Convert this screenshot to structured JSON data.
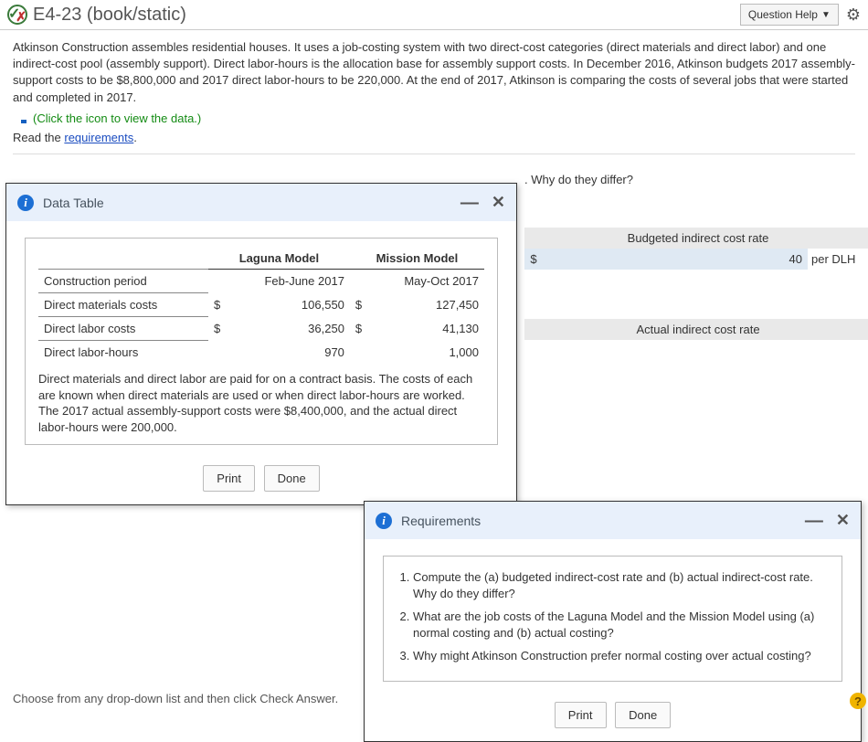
{
  "header": {
    "title": "E4-23 (book/static)",
    "help_label": "Question Help"
  },
  "problem_text": "Atkinson Construction assembles residential houses. It uses a job-costing system with two direct-cost categories (direct materials and direct labor) and one indirect-cost pool (assembly support). Direct labor-hours is the allocation base for assembly support costs. In December 2016, Atkinson budgets 2017 assembly-support costs to be $8,800,000 and 2017 direct labor-hours to be 220,000. At the end of 2017, Atkinson is comparing the costs of several jobs that were started and completed in 2017.",
  "data_hint": "(Click the icon to view the data.)",
  "read_prefix": "Read the ",
  "read_link": "requirements",
  "read_suffix": ".",
  "bg": {
    "why": ". Why do they differ?",
    "rate1_hdr": "Budgeted indirect cost rate",
    "rate1_cur": "$",
    "rate1_val": "40",
    "rate1_unit": "per DLH",
    "rate2_hdr": "Actual indirect cost rate"
  },
  "data_dialog": {
    "title": "Data Table",
    "col1": "Laguna Model",
    "col2": "Mission Model",
    "rows": [
      {
        "label": "Construction period",
        "cur1": "",
        "v1": "Feb-June 2017",
        "cur2": "",
        "v2": "May-Oct 2017"
      },
      {
        "label": "Direct materials costs",
        "cur1": "$",
        "v1": "106,550",
        "cur2": "$",
        "v2": "127,450"
      },
      {
        "label": "Direct labor costs",
        "cur1": "$",
        "v1": "36,250",
        "cur2": "$",
        "v2": "41,130"
      },
      {
        "label": "Direct labor-hours",
        "cur1": "",
        "v1": "970",
        "cur2": "",
        "v2": "1,000"
      }
    ],
    "note": "Direct materials and direct labor are paid for on a contract basis. The costs of each are known when direct materials are used or when direct labor-hours are worked. The 2017 actual assembly-support costs were $8,400,000, and the actual direct labor-hours were 200,000.",
    "print": "Print",
    "done": "Done"
  },
  "req_dialog": {
    "title": "Requirements",
    "items": [
      "Compute the (a) budgeted indirect-cost rate and (b) actual indirect-cost rate. Why do they differ?",
      "What are the job costs of the Laguna Model and the Mission Model using (a) normal costing and (b) actual costing?",
      "Why might Atkinson Construction prefer normal costing over actual costing?"
    ],
    "print": "Print",
    "done": "Done"
  },
  "footer_hint": "Choose from any drop-down list and then click Check Answer."
}
